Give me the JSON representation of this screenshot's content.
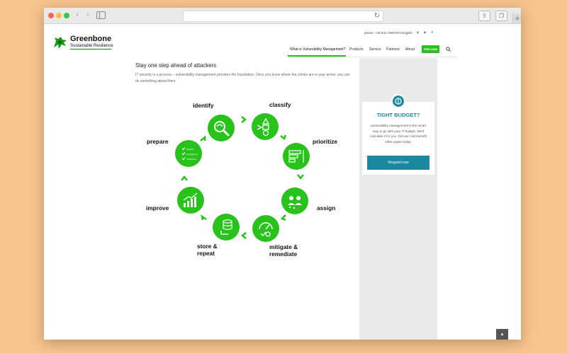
{
  "browser": {
    "back_label": "‹",
    "forward_label": "›",
    "reload_label": "↻",
    "new_tab_label": "+"
  },
  "brand": {
    "name": "Greenbone",
    "tagline": "Sustainable Resilience",
    "accent": "#27c21a"
  },
  "utility": {
    "phone": "phone: +49 541-760278-0",
    "language": "English"
  },
  "nav": {
    "items": [
      {
        "label": "What is Vulnerability Management?",
        "active": true
      },
      {
        "label": "Products"
      },
      {
        "label": "Service"
      },
      {
        "label": "Partners"
      },
      {
        "label": "About"
      }
    ],
    "cta": "Test now"
  },
  "main": {
    "headline": "Stay one step ahead of attackers",
    "intro": "IT security is a process – vulnerability management provides the foundation. Once you know where the chinks are in your armor, you can do something about them."
  },
  "cycle": {
    "color": "#27c21a",
    "steps": [
      {
        "label": "identify"
      },
      {
        "label": "classify"
      },
      {
        "label": "prioritize"
      },
      {
        "label": "assign"
      },
      {
        "label": "mitigate &",
        "label2": "remediate"
      },
      {
        "label": "store &",
        "label2": "repeat"
      },
      {
        "label": "improve"
      },
      {
        "label": "prepare"
      }
    ],
    "checklist": [
      "Policies",
      "Compliance",
      "Guidelines"
    ]
  },
  "sidebar": {
    "title": "TIGHT BUDGET?",
    "text": "Vulnerability management is the smart way to go with your IT budget. We'll calculate it for you. Get our cost-benefit white paper today.",
    "button": "Request now",
    "accent": "#1b8aa0"
  },
  "scroll_top_label": "▲"
}
